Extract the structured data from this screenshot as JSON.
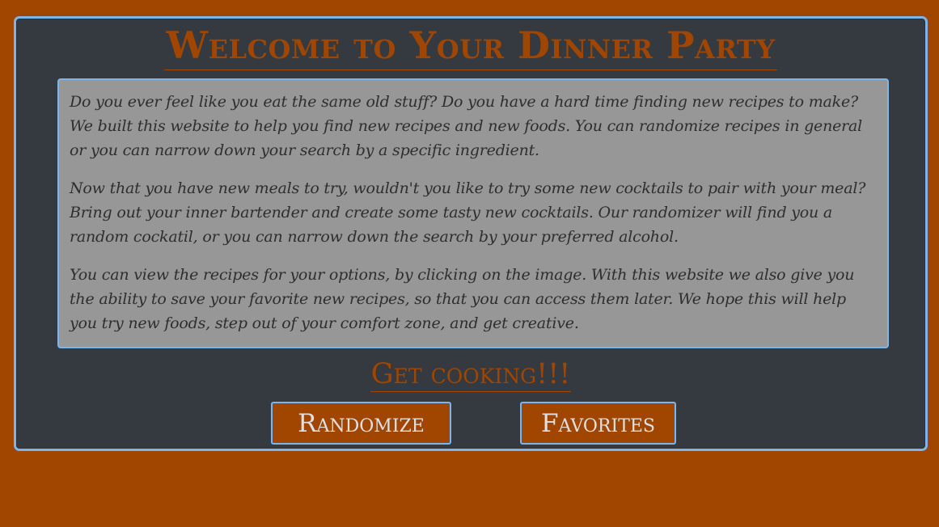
{
  "page": {
    "title": "Welcome to Your Dinner Party",
    "subtitle": "Get cooking!!!"
  },
  "intro": {
    "paragraphs": [
      "Do you ever feel like you eat the same old stuff? Do you have a hard time finding new recipes to make? We built this website to help you find new recipes and new foods. You can randomize recipes in general or you can narrow down your search by a specific ingredient.",
      "Now that you have new meals to try, wouldn't you like to try some new cocktails to pair with your meal? Bring out your inner bartender and create some tasty new cocktails. Our randomizer will find you a random cockatil, or you can narrow down the search by your preferred alcohol.",
      "You can view the recipes for your options, by clicking on the image. With this website we also give you the ability to save your favorite new recipes, so that you can access them later. We hope this will help you try new foods, step out of your comfort zone, and get creative."
    ]
  },
  "buttons": {
    "randomize_label": "Randomize",
    "favorites_label": "Favorites"
  },
  "colors": {
    "background": "#a04600",
    "panel": "#343a40",
    "accent_border": "#7cb5ec",
    "text_box": "#979797",
    "heading": "#a04600"
  }
}
